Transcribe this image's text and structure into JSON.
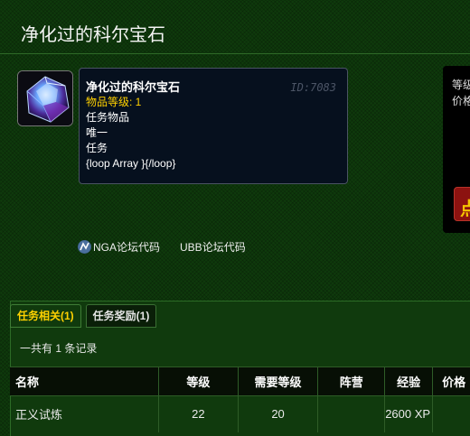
{
  "page": {
    "title": "净化过的科尔宝石"
  },
  "item": {
    "name": "净化过的科尔宝石",
    "id_label": "ID:7083",
    "item_level": "物品等级: 1",
    "type": "任务物品",
    "unique": "唯一",
    "category": "任务",
    "loop_text": "{loop Array }{/loop}",
    "icon": "blue-purple-gem-icon"
  },
  "side_panel": {
    "line1": "等级",
    "line2": "价格",
    "button_label": "点"
  },
  "code_links": [
    {
      "label": "NGA论坛代码",
      "icon": "nga-icon"
    },
    {
      "label": "UBB论坛代码"
    }
  ],
  "tabs": [
    {
      "label": "任务相关(1)",
      "active": true
    },
    {
      "label": "任务奖励(1)",
      "active": false
    }
  ],
  "record_count": "一共有 1 条记录",
  "table": {
    "headers": [
      "名称",
      "等级",
      "需要等级",
      "阵营",
      "经验",
      "价格"
    ],
    "rows": [
      [
        "正义试炼",
        "22",
        "20",
        "",
        "2600 XP",
        ""
      ]
    ]
  },
  "colors": {
    "accent_gold": "#ffd100",
    "background_green": "#0f3a0c"
  }
}
